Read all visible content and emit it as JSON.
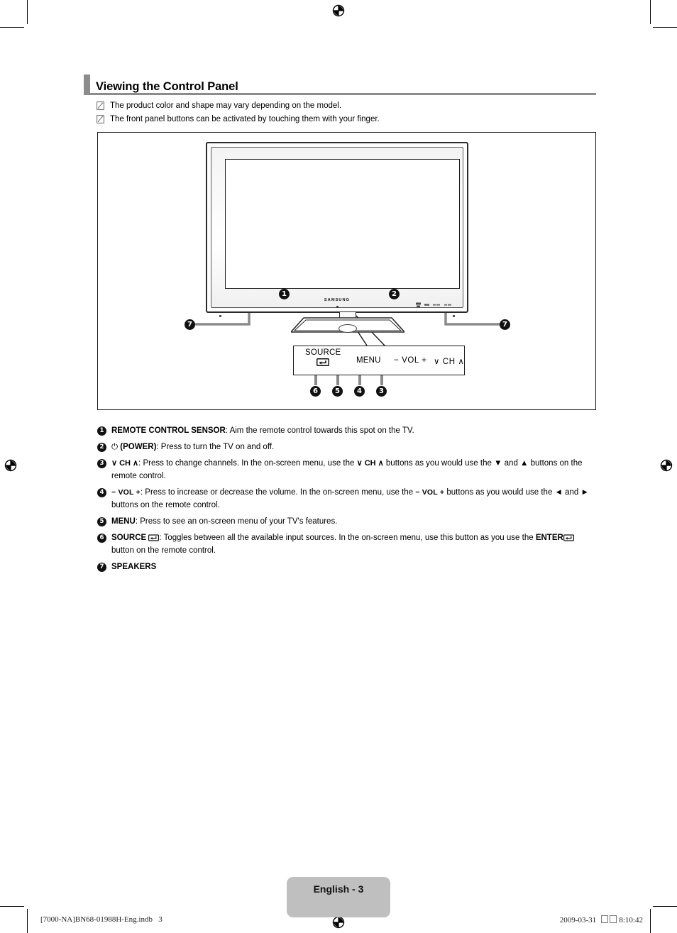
{
  "document": {
    "heading": "Viewing the Control Panel",
    "notes": [
      {
        "icon": "note-pencil-icon",
        "text": "The product color and shape may vary depending on the model."
      },
      {
        "icon": "note-pencil-icon",
        "text": "The front panel buttons can be activated by touching them with your finger."
      }
    ]
  },
  "figure": {
    "tv_brand_logo": "SAMSUNG",
    "control_panel": {
      "source_label": "SOURCE",
      "source_icon": "enter-arrow-icon",
      "menu_label": "MENU",
      "vol_label": "− VOL +",
      "ch_label": "∨ CH ∧"
    },
    "callouts": [
      {
        "number": "1",
        "target": "remote-control-sensor"
      },
      {
        "number": "2",
        "target": "power-button"
      },
      {
        "number": "3",
        "target": "ch-button"
      },
      {
        "number": "4",
        "target": "vol-button"
      },
      {
        "number": "5",
        "target": "menu-button"
      },
      {
        "number": "6",
        "target": "source-button"
      },
      {
        "number": "7",
        "target": "speaker-left"
      },
      {
        "number": "7",
        "target": "speaker-right"
      }
    ]
  },
  "descriptions": [
    {
      "number": "1",
      "term": "REMOTE CONTROL SENSOR",
      "text": ": Aim the remote control towards this spot on the TV."
    },
    {
      "number": "2",
      "term_prefix": "⏻ ",
      "term": "(POWER)",
      "text": ": Press to turn the TV on and off."
    },
    {
      "number": "3",
      "term": "∨ CH ∧",
      "text": ": Press to change channels. In the on-screen menu, use the ",
      "text_mid": "∨ CH ∧",
      "text_after": " buttons as you would use the ▼ and ▲ buttons on the remote control."
    },
    {
      "number": "4",
      "term": "− VOL +",
      "text": ": Press to increase or decrease the volume. In the on-screen menu, use the ",
      "text_mid": "− VOL +",
      "text_after": " buttons as you would use the ◄ and ► buttons on the remote control."
    },
    {
      "number": "5",
      "term": "MENU",
      "text": ": Press to see an on-screen menu of your TV's features."
    },
    {
      "number": "6",
      "term": "SOURCE",
      "icon": "enter-arrow-icon",
      "text": ": Toggles between all the available input sources. In the on-screen menu, use this button as you use the ",
      "term2": "ENTER",
      "icon2": "enter-arrow-icon",
      "text_after": " button on the remote control."
    },
    {
      "number": "7",
      "term": "SPEAKERS",
      "text": ""
    }
  ],
  "footer": {
    "page_tab": "English - 3",
    "print_file": "[7000-NA]BN68-01988H-Eng.indb   3",
    "print_date": "2009-03-31",
    "print_time": "8:10:42"
  },
  "colors": {
    "heading_accent": "#8c8c8c",
    "heading_rule": "#8c8c8c",
    "footer_tab": "#bfbfbf",
    "leader_line": "#8a8a8a",
    "bubble": "#111111"
  }
}
